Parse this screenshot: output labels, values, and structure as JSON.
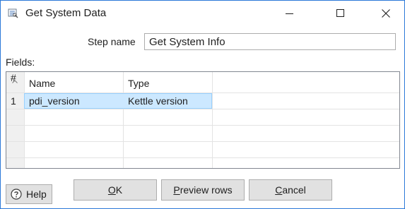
{
  "window": {
    "title": "Get System Data",
    "icon": "get-system-data-icon",
    "minimize_icon": "minimize-icon",
    "maximize_icon": "maximize-icon",
    "close_icon": "close-icon"
  },
  "form": {
    "step_name_label": "Step name",
    "step_name_value": "Get System Info",
    "fields_label": "Fields:"
  },
  "table": {
    "columns": [
      "#",
      "Name",
      "Type"
    ],
    "rows": [
      {
        "num": "1",
        "name": "pdi_version",
        "type": "Kettle version",
        "selected": true
      }
    ]
  },
  "buttons": {
    "ok": {
      "mnemonic": "O",
      "rest": "K"
    },
    "preview": {
      "mnemonic": "P",
      "rest": "review rows"
    },
    "cancel": {
      "mnemonic": "C",
      "rest": "ancel"
    },
    "help": "Help",
    "help_icon": "question-circle-icon"
  },
  "colors": {
    "window_border": "#2b79d8",
    "selection": "#cce8ff",
    "selection_border": "#99d1ff",
    "button_face": "#e1e1e1"
  }
}
